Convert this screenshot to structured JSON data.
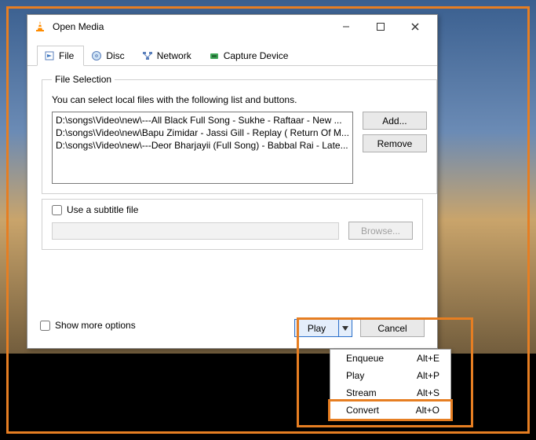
{
  "window": {
    "title": "Open Media"
  },
  "tabs": {
    "file": "File",
    "disc": "Disc",
    "network": "Network",
    "capture": "Capture Device"
  },
  "file_selection": {
    "legend": "File Selection",
    "hint": "You can select local files with the following list and buttons.",
    "files": [
      "D:\\songs\\Video\\new\\---All Black Full Song - Sukhe - Raftaar -  New ...",
      "D:\\songs\\Video\\new\\Bapu Zimidar - Jassi Gill - Replay ( Return Of M...",
      "D:\\songs\\Video\\new\\---Deor Bharjayii (Full Song) - Babbal Rai - Late..."
    ],
    "add": "Add...",
    "remove": "Remove"
  },
  "subtitle": {
    "check": "Use a subtitle file",
    "browse": "Browse..."
  },
  "footer": {
    "more": "Show more options",
    "play": "Play",
    "cancel": "Cancel"
  },
  "menu": {
    "items": [
      {
        "label": "Enqueue",
        "accel": "Alt+E"
      },
      {
        "label": "Play",
        "accel": "Alt+P"
      },
      {
        "label": "Stream",
        "accel": "Alt+S"
      },
      {
        "label": "Convert",
        "accel": "Alt+O"
      }
    ]
  }
}
